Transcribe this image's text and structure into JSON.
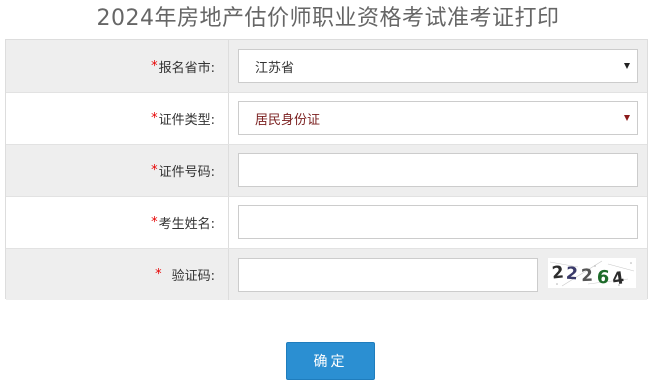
{
  "page": {
    "title": "2024年房地产估价师职业资格考试准考证打印"
  },
  "form": {
    "required_mark": "*",
    "province": {
      "label": "报名省市:",
      "selected": "江苏省"
    },
    "id_type": {
      "label": "证件类型:",
      "selected": "居民身份证"
    },
    "id_number": {
      "label": "证件号码:",
      "value": ""
    },
    "name": {
      "label": "考生姓名:",
      "value": ""
    },
    "captcha": {
      "label": "验证码:",
      "value": "",
      "image_text": [
        "2",
        "2",
        "2",
        "6",
        "4"
      ]
    },
    "submit_label": "确定"
  },
  "colors": {
    "row_shaded": "#eeeeee",
    "required_mark": "#e60000",
    "button_bg": "#2b8fd2",
    "title_text": "#666666"
  },
  "icons": {
    "select_caret": "dropdown-caret-icon"
  }
}
